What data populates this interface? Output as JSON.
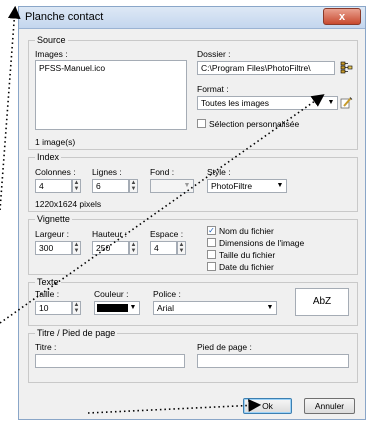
{
  "window": {
    "title": "Planche contact",
    "close_glyph": "x"
  },
  "source": {
    "title": "Source",
    "images_label": "Images :",
    "images": [
      "PFSS-Manuel.ico"
    ],
    "count": "1 image(s)",
    "folder_label": "Dossier :",
    "folder_value": "C:\\Program Files\\PhotoFiltre\\",
    "format_label": "Format :",
    "format_value": "Toutes les images",
    "custom_selection_label": "Sélection personnalisée",
    "custom_selection_checked": false
  },
  "index": {
    "title": "Index",
    "columns_label": "Colonnes :",
    "columns_value": "4",
    "rows_label": "Lignes :",
    "rows_value": "6",
    "background_label": "Fond :",
    "style_label": "Style :",
    "style_value": "PhotoFiltre",
    "size_text": "1220x1624 pixels"
  },
  "thumbnail": {
    "title": "Vignette",
    "width_label": "Largeur :",
    "width_value": "300",
    "height_label": "Hauteur :",
    "height_value": "250",
    "space_label": "Espace :",
    "space_value": "4",
    "options": [
      {
        "label": "Nom du fichier",
        "checked": true
      },
      {
        "label": "Dimensions de l'image",
        "checked": false
      },
      {
        "label": "Taille du fichier",
        "checked": false
      },
      {
        "label": "Date du fichier",
        "checked": false
      }
    ]
  },
  "text": {
    "title": "Texte",
    "size_label": "Taille :",
    "size_value": "10",
    "color_label": "Couleur :",
    "color_value": "#000000",
    "font_label": "Police :",
    "font_value": "Arial",
    "preview": "AbZ"
  },
  "title_footer": {
    "title": "Titre / Pied de page",
    "title_label": "Titre :",
    "footer_label": "Pied de page :"
  },
  "buttons": {
    "ok": "Ok",
    "cancel": "Annuler"
  },
  "colors": {
    "annotation": "#000000",
    "checkmark": "#1d5fb8"
  }
}
